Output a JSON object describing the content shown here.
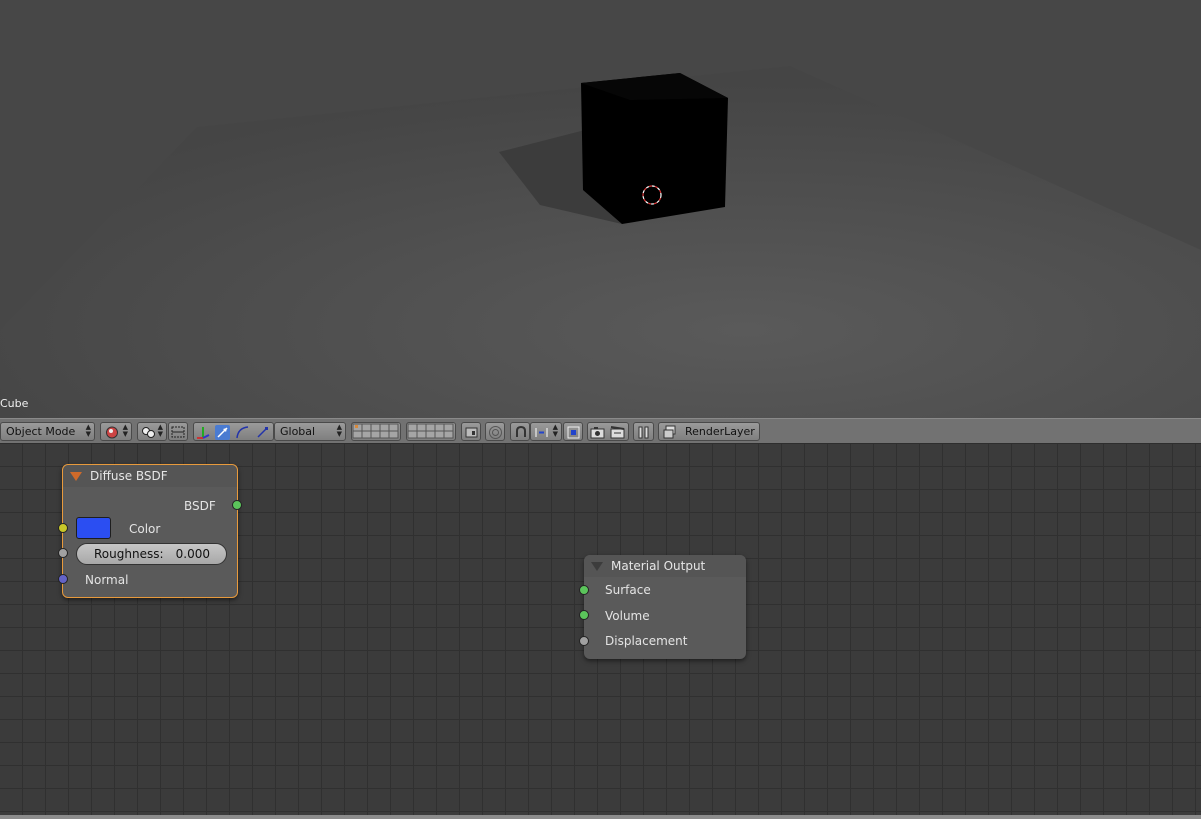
{
  "viewport": {
    "object_name": "Cube"
  },
  "header": {
    "mode_label": "Object Mode",
    "orientation_label": "Global",
    "render_layer_label": "RenderLayer"
  },
  "nodes": {
    "diffuse": {
      "title": "Diffuse BSDF",
      "output_label": "BSDF",
      "color_label": "Color",
      "color_value": "#2b4ef2",
      "roughness_label": "Roughness:",
      "roughness_value": "0.000",
      "normal_label": "Normal"
    },
    "output": {
      "title": "Material Output",
      "surface_label": "Surface",
      "volume_label": "Volume",
      "displacement_label": "Displacement"
    }
  },
  "colors": {
    "socket_shader": "#5bc55b",
    "socket_color": "#c7c729",
    "socket_value": "#a1a1a1",
    "socket_vector": "#6363c7",
    "node_selected_border": "#e89a3c"
  }
}
